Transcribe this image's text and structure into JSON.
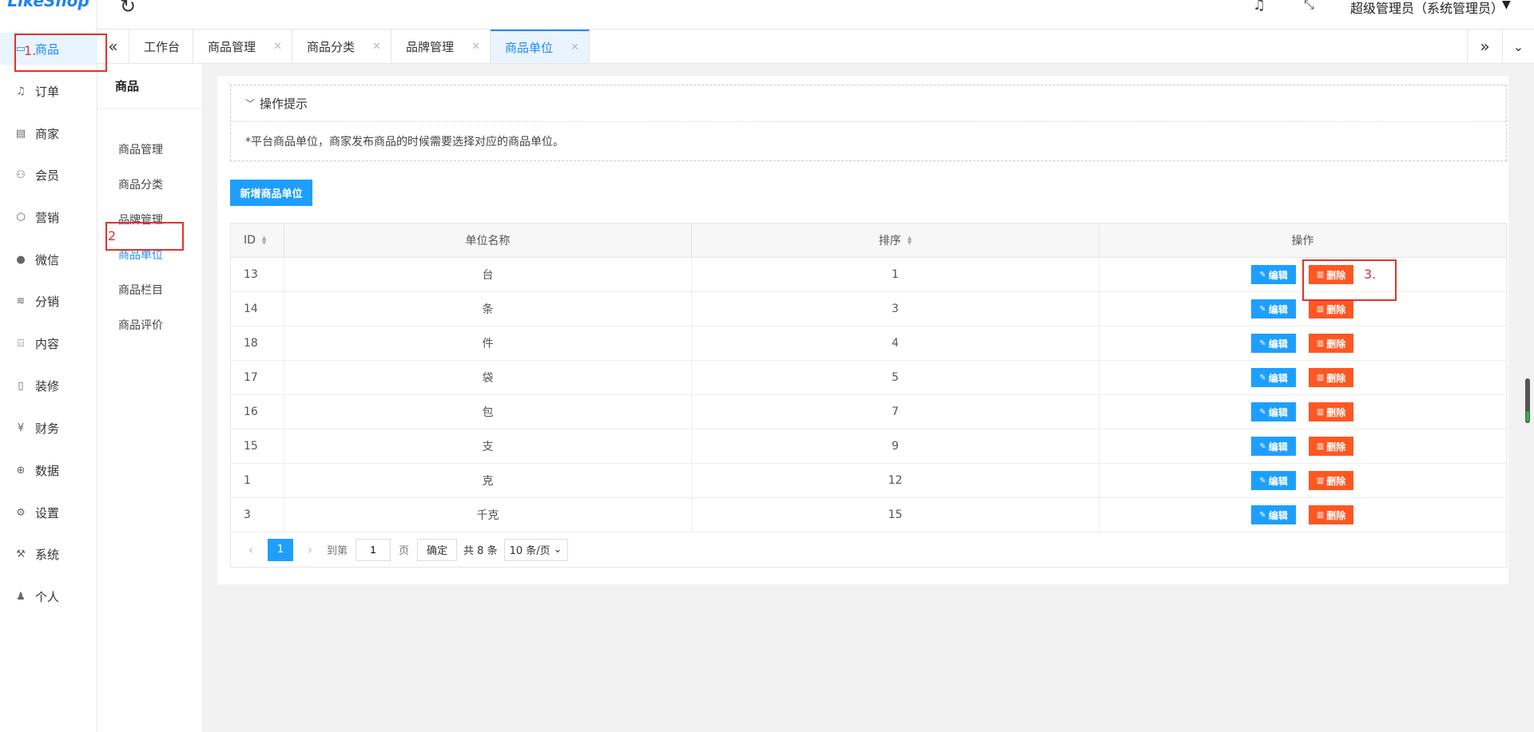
{
  "logo": "LikeShop",
  "sidebar": {
    "items": [
      {
        "label": "商品",
        "icon": "goods-icon"
      },
      {
        "label": "订单",
        "icon": "bell-icon"
      },
      {
        "label": "商家",
        "icon": "shop-icon"
      },
      {
        "label": "会员",
        "icon": "user-icon"
      },
      {
        "label": "营销",
        "icon": "box-icon"
      },
      {
        "label": "微信",
        "icon": "wechat-icon"
      },
      {
        "label": "分销",
        "icon": "layers-icon"
      },
      {
        "label": "内容",
        "icon": "book-icon"
      },
      {
        "label": "装修",
        "icon": "phone-icon"
      },
      {
        "label": "财务",
        "icon": "yen-icon"
      },
      {
        "label": "数据",
        "icon": "globe-icon"
      },
      {
        "label": "设置",
        "icon": "gear-icon"
      },
      {
        "label": "系统",
        "icon": "tools-icon"
      },
      {
        "label": "个人",
        "icon": "person-icon"
      }
    ]
  },
  "subnav": {
    "title": "商品",
    "items": [
      "商品管理",
      "商品分类",
      "品牌管理",
      "商品单位",
      "商品栏目",
      "商品评价"
    ]
  },
  "header": {
    "user": "超级管理员（系统管理员）"
  },
  "tabs": [
    "工作台",
    "商品管理",
    "商品分类",
    "品牌管理",
    "商品单位"
  ],
  "tips": {
    "title": "操作提示",
    "text": "*平台商品单位，商家发布商品的时候需要选择对应的商品单位。"
  },
  "add_button": "新增商品单位",
  "table": {
    "headers": {
      "id": "ID",
      "name": "单位名称",
      "sort": "排序",
      "op": "操作"
    },
    "edit_label": "编辑",
    "delete_label": "删除",
    "rows": [
      {
        "id": "13",
        "name": "台",
        "sort": "1"
      },
      {
        "id": "14",
        "name": "条",
        "sort": "3"
      },
      {
        "id": "18",
        "name": "件",
        "sort": "4"
      },
      {
        "id": "17",
        "name": "袋",
        "sort": "5"
      },
      {
        "id": "16",
        "name": "包",
        "sort": "7"
      },
      {
        "id": "15",
        "name": "支",
        "sort": "9"
      },
      {
        "id": "1",
        "name": "克",
        "sort": "12"
      },
      {
        "id": "3",
        "name": "千克",
        "sort": "15"
      }
    ]
  },
  "pager": {
    "current": "1",
    "goto_label": "到第",
    "goto_value": "1",
    "page_label": "页",
    "ok_label": "确定",
    "total": "共 8 条",
    "page_size": "10 条/页"
  },
  "annotations": [
    "1.",
    "2",
    "3."
  ],
  "colors": {
    "accent": "#1e9fff",
    "danger": "#ff5722",
    "annotation": "#e3322b"
  }
}
